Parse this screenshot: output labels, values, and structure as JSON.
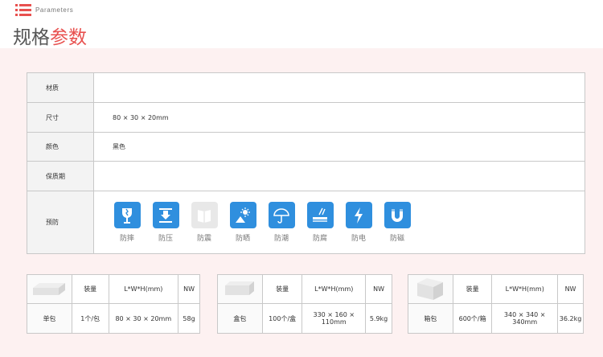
{
  "header": {
    "en_title": "Parameters",
    "cn_title_main": "规格",
    "cn_title_accent": "参数",
    "accent_color": "#e8514f"
  },
  "params": [
    {
      "label": "材质",
      "value": ""
    },
    {
      "label": "尺寸",
      "value": "80 × 30 × 20mm"
    },
    {
      "label": "颜色",
      "value": "黑色"
    },
    {
      "label": "保质期",
      "value": ""
    },
    {
      "label": "预防",
      "value": ""
    }
  ],
  "prevention_icons": [
    {
      "icon": "fragile-icon",
      "label": "防摔"
    },
    {
      "icon": "compression-icon",
      "label": "防压"
    },
    {
      "icon": "shock-icon",
      "label": "防震"
    },
    {
      "icon": "sun-icon",
      "label": "防晒"
    },
    {
      "icon": "umbrella-icon",
      "label": "防潮"
    },
    {
      "icon": "corrosion-icon",
      "label": "防腐"
    },
    {
      "icon": "lightning-icon",
      "label": "防电"
    },
    {
      "icon": "magnet-icon",
      "label": "防磁"
    }
  ],
  "icon_color": "#2f8fde",
  "packaging": [
    {
      "name": "单包",
      "headers": [
        "装量",
        "L*W*H(mm)",
        "NW"
      ],
      "qty": "1个/包",
      "dims": "80 × 30 × 20mm",
      "nw": "58g"
    },
    {
      "name": "盒包",
      "headers": [
        "装量",
        "L*W*H(mm)",
        "NW"
      ],
      "qty": "100个/盒",
      "dims": "330 × 160 × 110mm",
      "nw": "5.9kg"
    },
    {
      "name": "箱包",
      "headers": [
        "装量",
        "L*W*H(mm)",
        "NW"
      ],
      "qty": "600个/箱",
      "dims": "340 × 340 × 340mm",
      "nw": "36.2kg"
    }
  ]
}
